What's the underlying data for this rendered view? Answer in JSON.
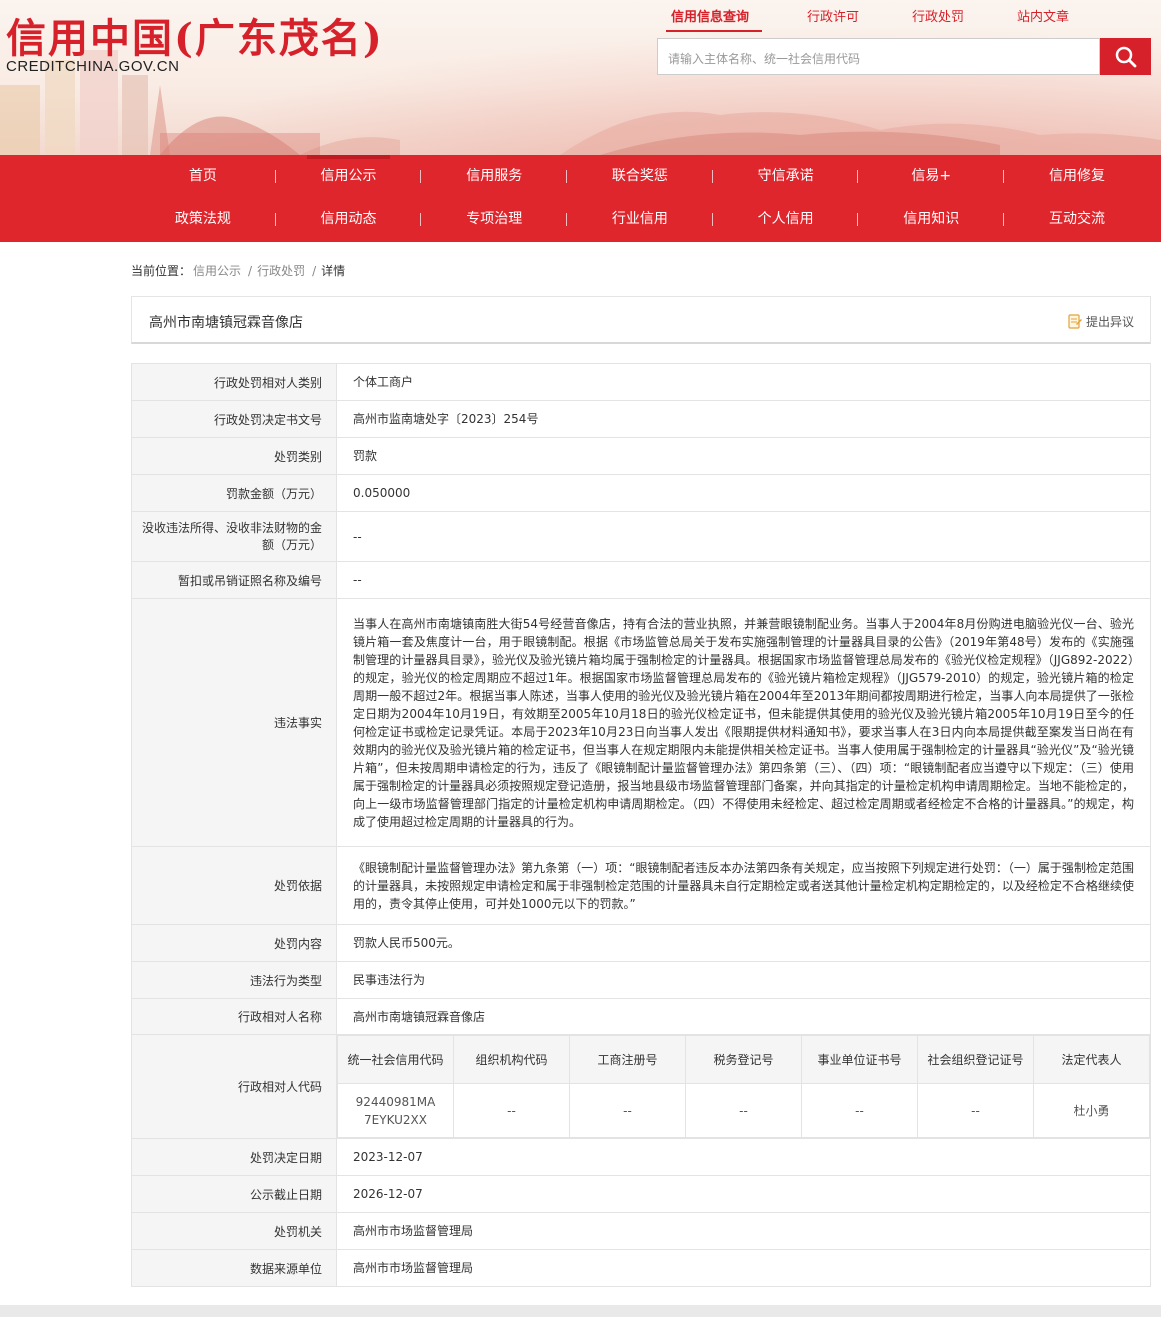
{
  "header": {
    "site_title": "信用中国(广东茂名)",
    "site_domain": "CREDITCHINA.GOV.CN",
    "top_links": [
      "信用信息查询",
      "行政许可",
      "行政处罚",
      "站内文章"
    ],
    "search_placeholder": "请输入主体名称、统一社会信用代码",
    "search_icon": "search-icon"
  },
  "nav": {
    "row1": [
      "首页",
      "信用公示",
      "信用服务",
      "联合奖惩",
      "守信承诺",
      "信易+",
      "信用修复"
    ],
    "row2": [
      "政策法规",
      "信用动态",
      "专项治理",
      "行业信用",
      "个人信用",
      "信用知识",
      "互动交流"
    ]
  },
  "breadcrumb": {
    "label": "当前位置：",
    "items": [
      "信用公示",
      "行政处罚",
      "详情"
    ]
  },
  "record": {
    "name": "高州市南塘镇冠霖音像店",
    "objection_label": "提出异议"
  },
  "fields": {
    "party_type": {
      "label": "行政处罚相对人类别",
      "value": "个体工商户"
    },
    "doc_no": {
      "label": "行政处罚决定书文号",
      "value": "高州市监南塘处字〔2023〕254号"
    },
    "penalty_type": {
      "label": "处罚类别",
      "value": "罚款"
    },
    "fine": {
      "label": "罚款金额（万元）",
      "value": "0.050000"
    },
    "confiscated": {
      "label": "没收违法所得、没收非法财物的金额（万元）",
      "value": "--"
    },
    "license": {
      "label": "暂扣或吊销证照名称及编号",
      "value": "--"
    },
    "facts": {
      "label": "违法事实",
      "value": "当事人在高州市南塘镇南胜大街54号经营音像店，持有合法的营业执照，并兼营眼镜制配业务。当事人于2004年8月份购进电脑验光仪一台、验光镜片箱一套及焦度计一台，用于眼镜制配。根据《市场监管总局关于发布实施强制管理的计量器具目录的公告》（2019年第48号）发布的《实施强制管理的计量器具目录》，验光仪及验光镜片箱均属于强制检定的计量器具。根据国家市场监督管理总局发布的《验光仪检定规程》（JJG892-2022）的规定，验光仪的检定周期应不超过1年。根据国家市场监督管理总局发布的《验光镜片箱检定规程》（JJG579-2010）的规定，验光镜片箱的检定周期一般不超过2年。根据当事人陈述，当事人使用的验光仪及验光镜片箱在2004年至2013年期间都按周期进行检定，当事人向本局提供了一张检定日期为2004年10月19日，有效期至2005年10月18日的验光仪检定证书，但未能提供其使用的验光仪及验光镜片箱2005年10月19日至今的任何检定证书或检定记录凭证。本局于2023年10月23日向当事人发出《限期提供材料通知书》，要求当事人在3日内向本局提供截至案发当日尚在有效期内的验光仪及验光镜片箱的检定证书，但当事人在规定期限内未能提供相关检定证书。当事人使用属于强制检定的计量器具“验光仪”及“验光镜片箱”，但未按周期申请检定的行为，违反了《眼镜制配计量监督管理办法》第四条第（三）、（四）项：“眼镜制配者应当遵守以下规定：（三）使用属于强制检定的计量器具必须按照规定登记造册，报当地县级市场监督管理部门备案，并向其指定的计量检定机构申请周期检定。当地不能检定的，向上一级市场监督管理部门指定的计量检定机构申请周期检定。（四）不得使用未经检定、超过检定周期或者经检定不合格的计量器具。”的规定，构成了使用超过检定周期的计量器具的行为。"
    },
    "basis": {
      "label": "处罚依据",
      "value": "《眼镜制配计量监督管理办法》第九条第（一）项：“眼镜制配者违反本办法第四条有关规定，应当按照下列规定进行处罚：（一）属于强制检定范围的计量器具，未按照规定申请检定和属于非强制检定范围的计量器具未自行定期检定或者送其他计量检定机构定期检定的，以及经检定不合格继续使用的，责令其停止使用，可并处1000元以下的罚款。”"
    },
    "content": {
      "label": "处罚内容",
      "value": "罚款人民币500元。"
    },
    "violation_type": {
      "label": "违法行为类型",
      "value": "民事违法行为"
    },
    "party_name": {
      "label": "行政相对人名称",
      "value": "高州市南塘镇冠霖音像店"
    },
    "party_code": {
      "label": "行政相对人代码",
      "headers": [
        "统一社会信用代码",
        "组织机构代码",
        "工商注册号",
        "税务登记号",
        "事业单位证书号",
        "社会组织登记证号",
        "法定代表人"
      ],
      "values": [
        "92440981MA7EYKU2XX",
        "--",
        "--",
        "--",
        "--",
        "--",
        "杜小勇"
      ]
    },
    "decision_date": {
      "label": "处罚决定日期",
      "value": "2023-12-07"
    },
    "publish_deadline": {
      "label": "公示截止日期",
      "value": "2026-12-07"
    },
    "authority": {
      "label": "处罚机关",
      "value": "高州市市场监督管理局"
    },
    "data_source": {
      "label": "数据来源单位",
      "value": "高州市市场监督管理局"
    }
  }
}
